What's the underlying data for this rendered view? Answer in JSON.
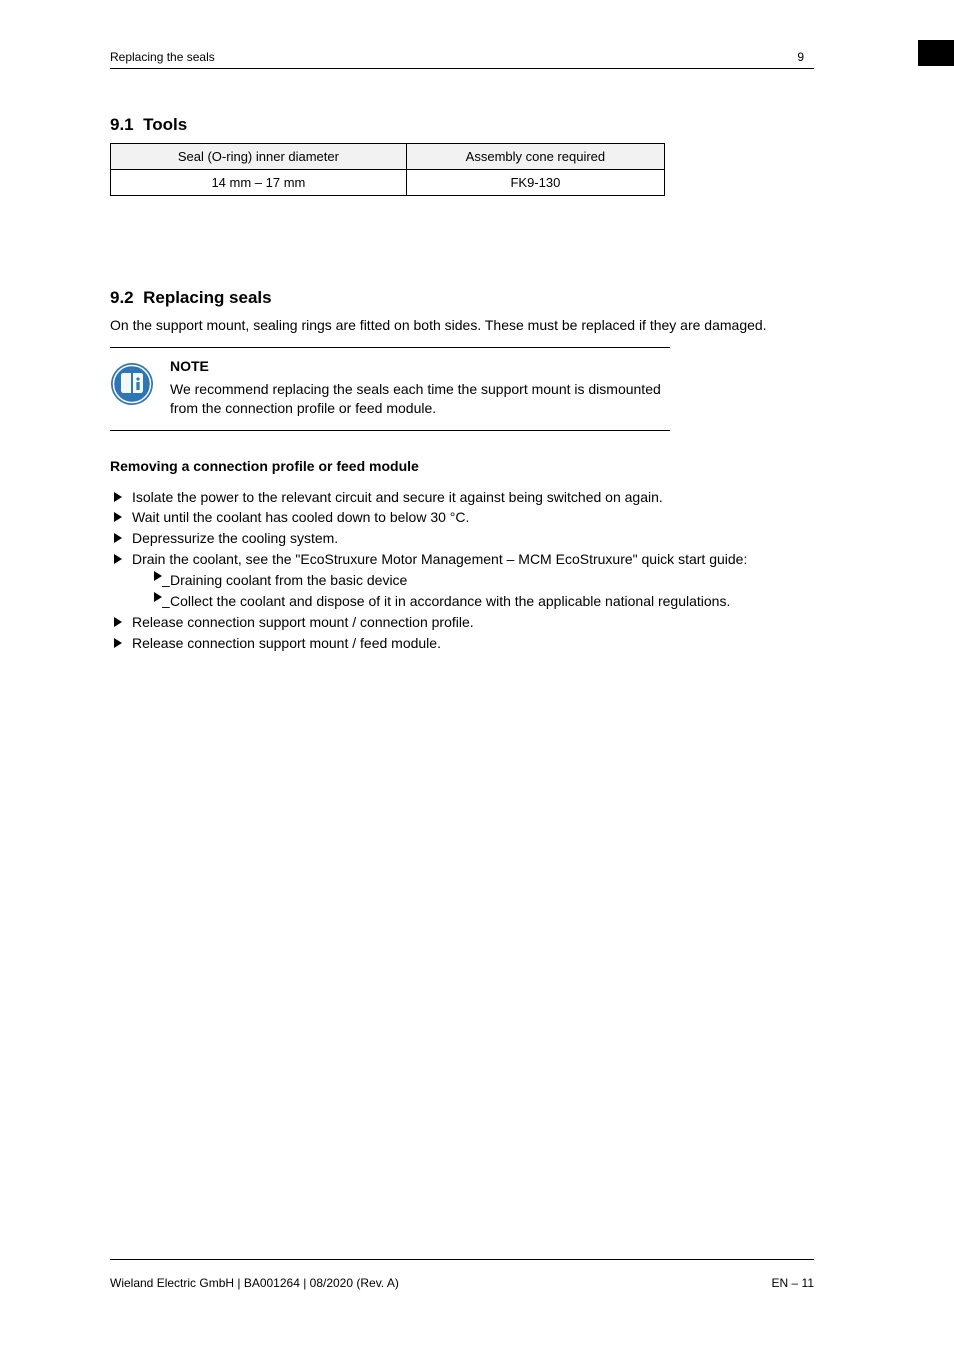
{
  "header": {
    "left": "Replacing the seals",
    "right": "9"
  },
  "section1": {
    "number": "9.1",
    "title": "Tools",
    "table": {
      "h1": "Seal (O-ring) inner diameter",
      "h2": "Assembly cone required",
      "c1": "14 mm – 17 mm",
      "c2": "FK9-130"
    }
  },
  "section2": {
    "number": "9.2",
    "title": "Replacing seals",
    "para1": "On the support mount, sealing rings are fitted on both sides. These must be replaced if they are damaged.",
    "note": {
      "title": "NOTE",
      "text": "We recommend replacing the seals each time the support mount is dismounted from the connection profile or feed module."
    },
    "heading2": "Removing a connection profile or feed module",
    "items": [
      {
        "lead": "Isolate the power to the relevant circuit and secure it against being switched on again.",
        "sub": []
      },
      {
        "lead": "Wait until the coolant has cooled down to below 30 °C.",
        "sub": []
      },
      {
        "lead": "Depressurize the cooling system.",
        "sub": []
      },
      {
        "lead": "Drain the coolant, see the \"EcoStruxure Motor Management – MCM EcoStruxure\" quick start guide:",
        "sub": [
          "Draining coolant from the basic device",
          "Collect the coolant and dispose of it in accordance with the applicable national regulations."
        ]
      },
      {
        "lead": "Release connection support mount / connection profile.",
        "sub": []
      },
      {
        "lead": "Release connection support mount / feed module.",
        "sub": []
      }
    ]
  },
  "footer": {
    "left": "Wieland Electric GmbH | BA001264 | 08/2020 (Rev. A)",
    "right": "EN – 11"
  }
}
